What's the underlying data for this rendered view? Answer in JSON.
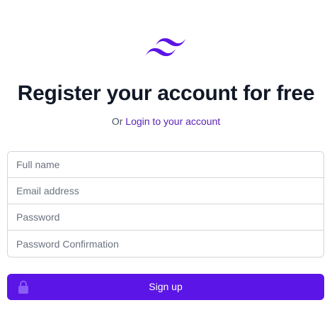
{
  "brand": {
    "logo_icon": "tailwind-logo-icon",
    "accent": "#5b15e6"
  },
  "header": {
    "title": "Register your account for free",
    "subtitle_prefix": "Or",
    "login_link": "Login to your account"
  },
  "form": {
    "full_name": {
      "placeholder": "Full name",
      "value": ""
    },
    "email": {
      "placeholder": "Email address",
      "value": ""
    },
    "password": {
      "placeholder": "Password",
      "value": ""
    },
    "password_confirmation": {
      "placeholder": "Password Confirmation",
      "value": ""
    }
  },
  "signup_button": {
    "label": "Sign up",
    "icon": "lock-icon"
  }
}
